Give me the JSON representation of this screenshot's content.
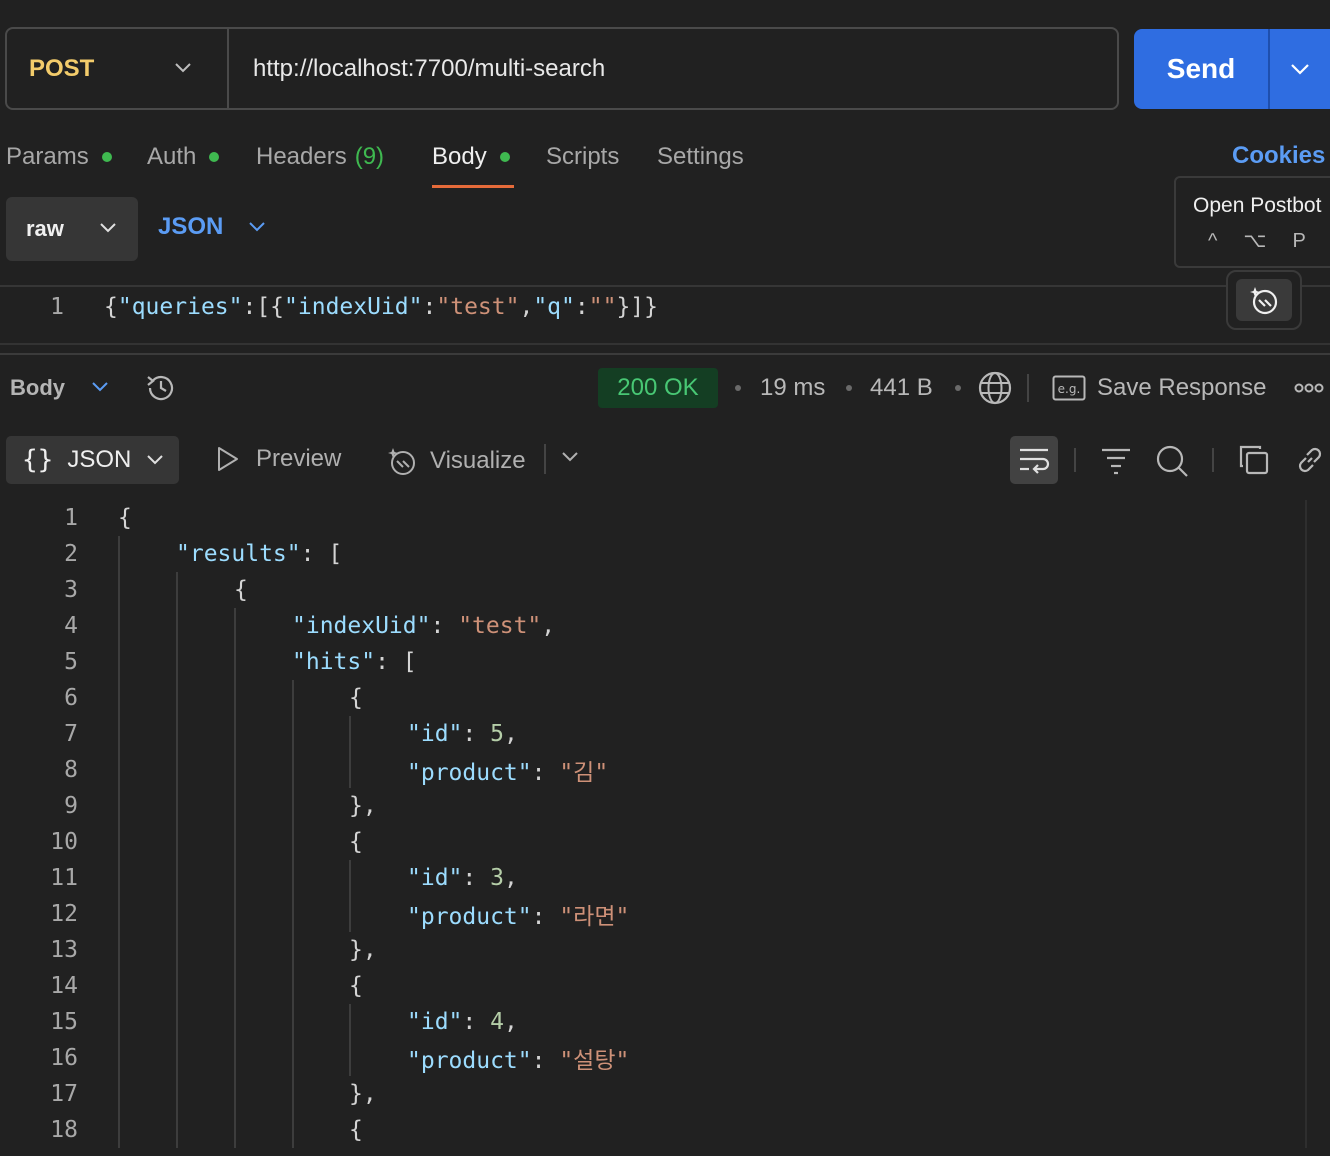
{
  "request": {
    "method": "POST",
    "url": "http://localhost:7700/multi-search",
    "send_label": "Send"
  },
  "tabs": {
    "params": "Params",
    "auth": "Auth",
    "headers": "Headers",
    "headers_count": "(9)",
    "body": "Body",
    "scripts": "Scripts",
    "settings": "Settings",
    "cookies": "Cookies"
  },
  "body_mode": {
    "mode": "raw",
    "format": "JSON"
  },
  "postbot": {
    "title": "Open Postbot",
    "keys": [
      "^",
      "⌥",
      "P"
    ]
  },
  "request_body": {
    "line_number": "1",
    "text": "{\"queries\":[{\"indexUid\":\"test\",\"q\":\"\"}]}"
  },
  "response": {
    "section_label": "Body",
    "status": "200 OK",
    "time": "19 ms",
    "size": "441 B",
    "save_label": "Save Response",
    "format": "JSON",
    "preview_label": "Preview",
    "visualize_label": "Visualize",
    "lines": [
      {
        "n": "1"
      },
      {
        "n": "2"
      },
      {
        "n": "3"
      },
      {
        "n": "4"
      },
      {
        "n": "5"
      },
      {
        "n": "6"
      },
      {
        "n": "7"
      },
      {
        "n": "8"
      },
      {
        "n": "9"
      },
      {
        "n": "10"
      },
      {
        "n": "11"
      },
      {
        "n": "12"
      },
      {
        "n": "13"
      },
      {
        "n": "14"
      },
      {
        "n": "15"
      },
      {
        "n": "16"
      },
      {
        "n": "17"
      },
      {
        "n": "18"
      }
    ],
    "tokens": {
      "results": "\"results\"",
      "indexUid": "\"indexUid\"",
      "test": "\"test\"",
      "hits": "\"hits\"",
      "id": "\"id\"",
      "product": "\"product\"",
      "id1": "5",
      "product1": "\"김\"",
      "id2": "3",
      "product2": "\"라면\"",
      "id3": "4",
      "product3": "\"설탕\""
    }
  },
  "colors": {
    "accent": "#2f6de1",
    "method": "#f3cc6b",
    "status_ok": "#48c774",
    "tab_indicator": "#e66b3a",
    "link": "#5b9cf4"
  }
}
